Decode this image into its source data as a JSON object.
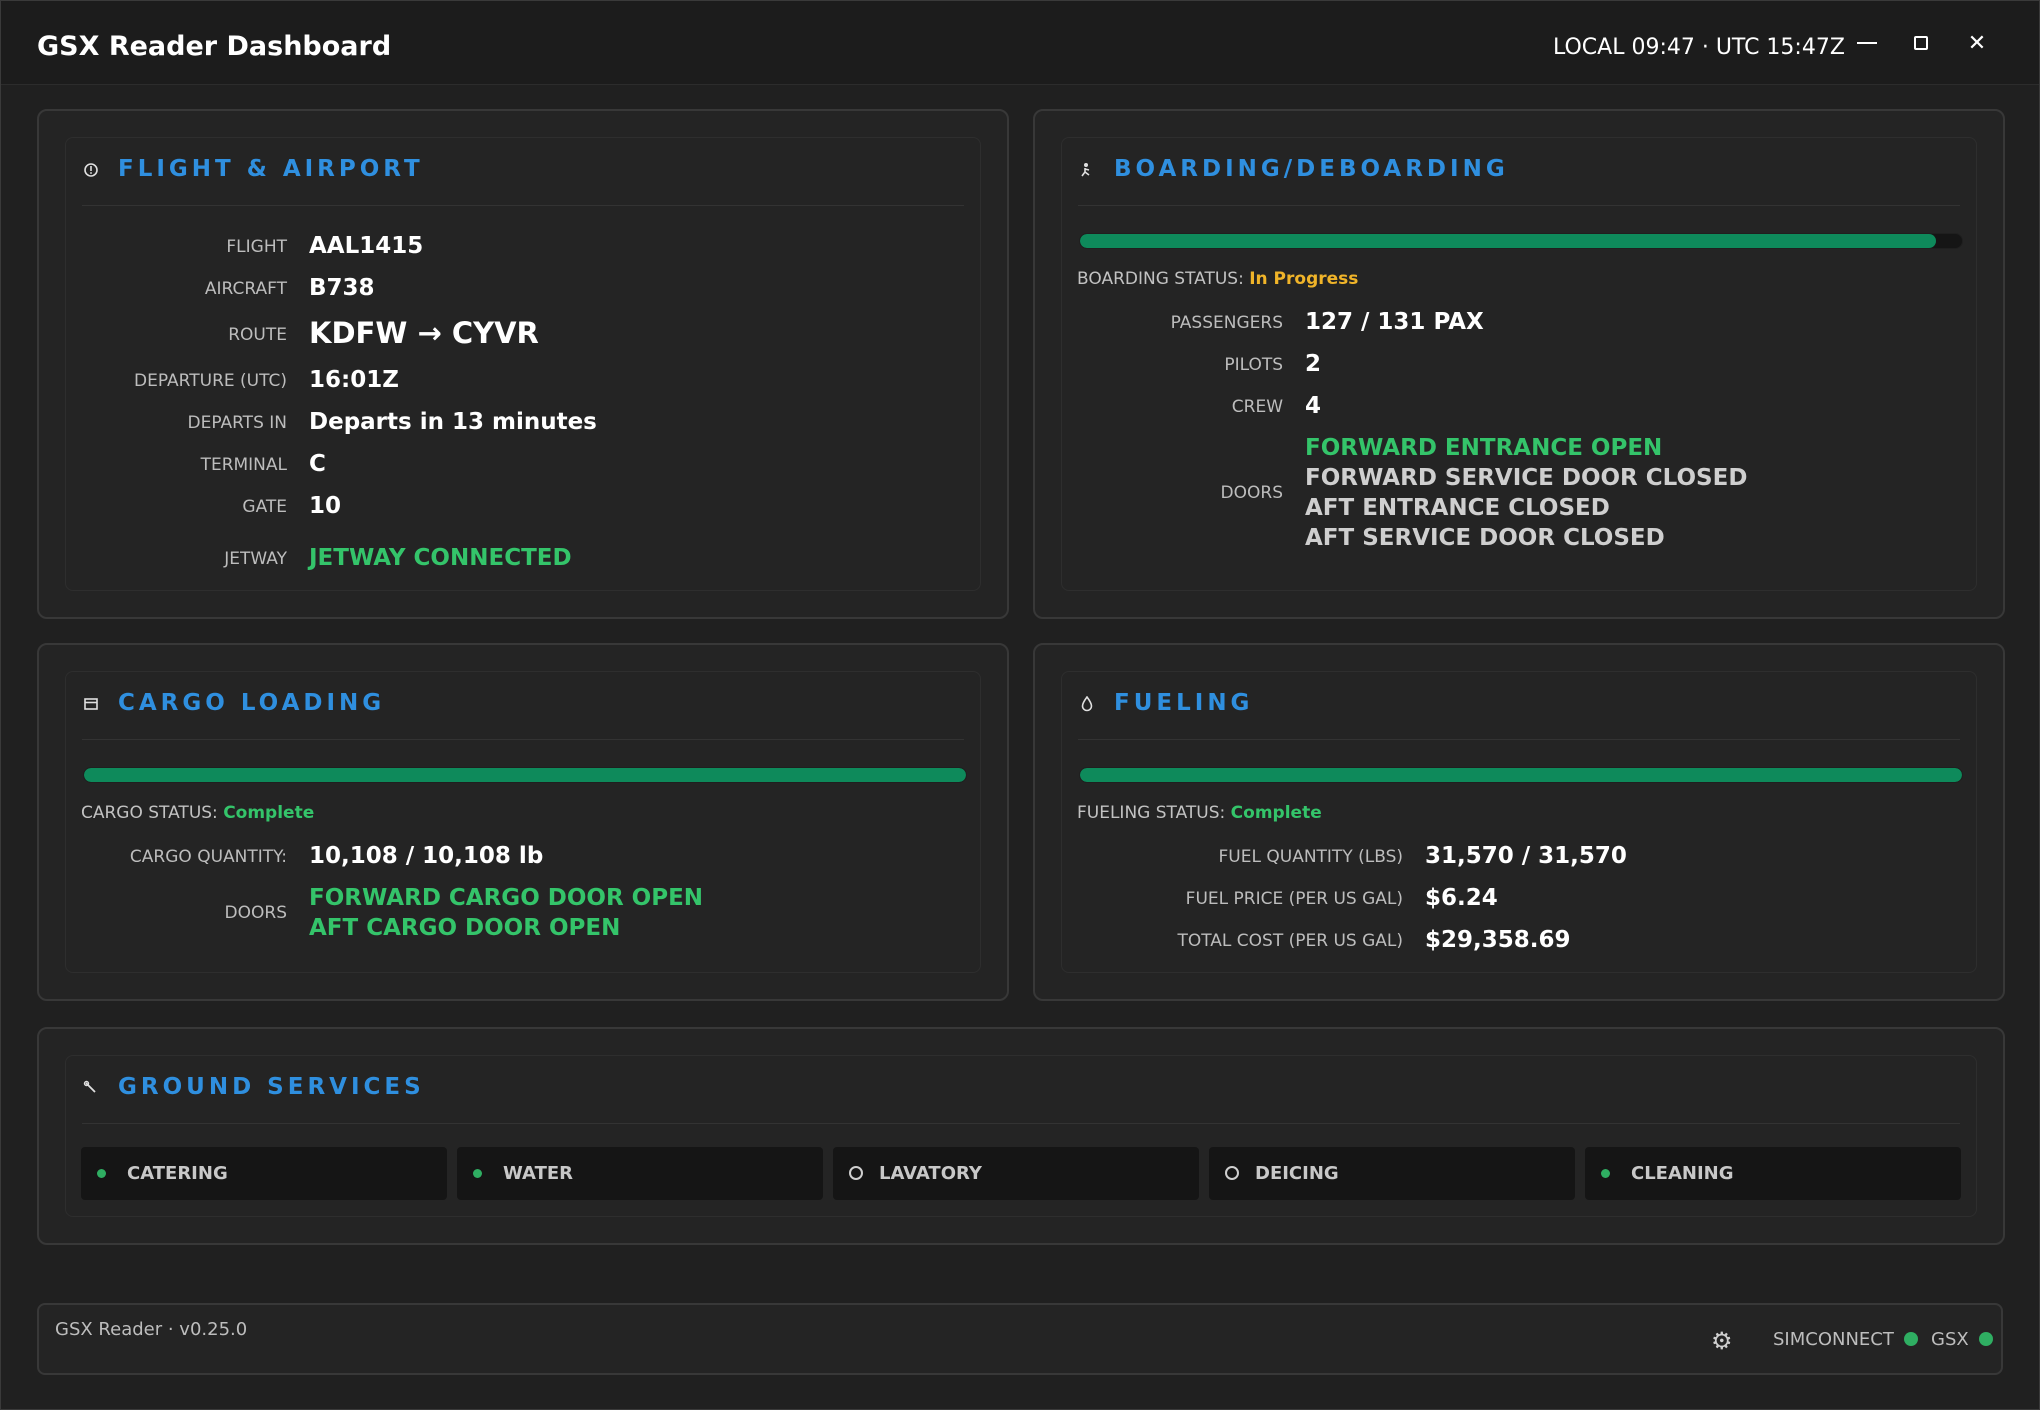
{
  "window": {
    "title": "GSX Reader Dashboard",
    "clock": "LOCAL 09:47 · UTC 15:47Z"
  },
  "flight": {
    "title": "FLIGHT & AIRPORT",
    "icon": "info-icon",
    "rows": {
      "flight": {
        "label": "FLIGHT",
        "value": "AAL1415"
      },
      "aircraft": {
        "label": "AIRCRAFT",
        "value": "B738"
      },
      "route": {
        "label": "ROUTE",
        "value": "KDFW → CYVR"
      },
      "departure": {
        "label": "DEPARTURE (UTC)",
        "value": "16:01Z"
      },
      "departs_in": {
        "label": "DEPARTS IN",
        "value": "Departs in 13 minutes"
      },
      "terminal": {
        "label": "TERMINAL",
        "value": "C"
      },
      "gate": {
        "label": "GATE",
        "value": "10"
      },
      "jetway": {
        "label": "JETWAY",
        "value": "JETWAY CONNECTED"
      }
    }
  },
  "boarding": {
    "title": "BOARDING/DEBOARDING",
    "icon": "person-walking-icon",
    "progress_fraction": 0.97,
    "status_label": "BOARDING STATUS:",
    "status_value": "In Progress",
    "rows": {
      "passengers": {
        "label": "PASSENGERS",
        "value": "127 / 131 PAX"
      },
      "pilots": {
        "label": "PILOTS",
        "value": "2"
      },
      "crew": {
        "label": "CREW",
        "value": "4"
      }
    },
    "doors_label": "DOORS",
    "doors": [
      {
        "text": "FORWARD ENTRANCE OPEN",
        "open": true
      },
      {
        "text": "FORWARD SERVICE DOOR CLOSED",
        "open": false
      },
      {
        "text": "AFT ENTRANCE CLOSED",
        "open": false
      },
      {
        "text": "AFT SERVICE DOOR CLOSED",
        "open": false
      }
    ]
  },
  "cargo": {
    "title": "CARGO LOADING",
    "icon": "package-icon",
    "progress_fraction": 1.0,
    "status_label": "CARGO STATUS:",
    "status_value": "Complete",
    "quantity": {
      "label": "CARGO QUANTITY:",
      "value": "10,108 / 10,108 lb"
    },
    "doors_label": "DOORS",
    "doors": [
      {
        "text": "FORWARD CARGO DOOR OPEN",
        "open": true
      },
      {
        "text": "AFT CARGO DOOR OPEN",
        "open": true
      }
    ]
  },
  "fueling": {
    "title": "FUELING",
    "icon": "fuel-drop-icon",
    "progress_fraction": 1.0,
    "status_label": "FUELING STATUS:",
    "status_value": "Complete",
    "rows": {
      "quantity": {
        "label": "FUEL QUANTITY (LBS)",
        "value": "31,570 / 31,570"
      },
      "price": {
        "label": "FUEL PRICE (PER US GAL)",
        "value": "$6.24"
      },
      "total": {
        "label": "TOTAL COST (PER US GAL)",
        "value": "$29,358.69"
      }
    }
  },
  "ground": {
    "title": "GROUND SERVICES",
    "icon": "wrench-icon",
    "services": [
      {
        "label": "CATERING",
        "active": true
      },
      {
        "label": "WATER",
        "active": true
      },
      {
        "label": "LAVATORY",
        "active": false
      },
      {
        "label": "DEICING",
        "active": false
      },
      {
        "label": "CLEANING",
        "active": true
      }
    ]
  },
  "footer": {
    "version": "GSX Reader · v0.25.0",
    "simconnect_label": "SIMCONNECT",
    "gsx_label": "GSX",
    "status_color": "#2fae62"
  },
  "colors": {
    "accent": "#2f8fdf",
    "success": "#34c46a",
    "warning": "#f0b429",
    "progress": "#0e8a5b"
  }
}
